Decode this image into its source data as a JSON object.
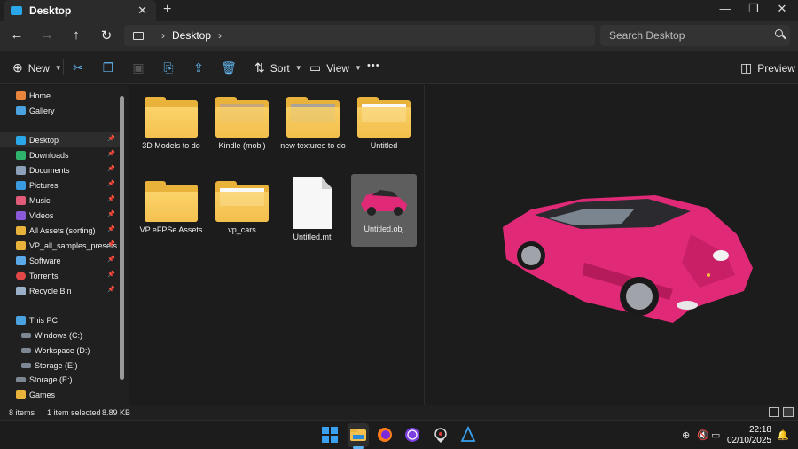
{
  "window": {
    "tab_title": "Desktop",
    "tab_close": "✕",
    "new_tab": "+",
    "minimize": "—",
    "restore": "❐",
    "close": "✕"
  },
  "nav": {
    "back": "←",
    "forward": "→",
    "up": "↑",
    "refresh": "↻",
    "address_sep": "›",
    "breadcrumb": "Desktop",
    "search_placeholder": "Search Desktop"
  },
  "toolbar": {
    "new_label": "New",
    "sort_label": "Sort",
    "view_label": "View",
    "more_label": "•••",
    "preview_label": "Preview"
  },
  "sidebar": {
    "quick": [
      {
        "label": "Home",
        "icon": "home-icon",
        "color": "#e8843c"
      },
      {
        "label": "Gallery",
        "icon": "gallery-icon",
        "color": "#4aa3e0"
      }
    ],
    "pinned": [
      {
        "label": "Desktop",
        "icon": "desktop-icon",
        "color": "#2aa7e8"
      },
      {
        "label": "Downloads",
        "icon": "downloads-icon",
        "color": "#2fb36b"
      },
      {
        "label": "Documents",
        "icon": "documents-icon",
        "color": "#8ca0b8"
      },
      {
        "label": "Pictures",
        "icon": "pictures-icon",
        "color": "#3a9be0"
      },
      {
        "label": "Music",
        "icon": "music-icon",
        "color": "#e05a7a"
      },
      {
        "label": "Videos",
        "icon": "videos-icon",
        "color": "#8a5ad8"
      },
      {
        "label": "All Assets (sorting)",
        "icon": "folder-icon",
        "color": "#e9b33b"
      },
      {
        "label": "VP_all_samples_presets",
        "icon": "folder-icon",
        "color": "#e9b33b"
      },
      {
        "label": "Software",
        "icon": "monitor-icon",
        "color": "#5aa9e6"
      },
      {
        "label": "Torrents",
        "icon": "magnet-icon",
        "color": "#e04848"
      },
      {
        "label": "Recycle Bin",
        "icon": "recycle-bin-icon",
        "color": "#9ab0c8"
      }
    ],
    "this_pc": "This PC",
    "drives": [
      {
        "label": "Windows (C:)",
        "icon": "drive-icon"
      },
      {
        "label": "Workspace (D:)",
        "icon": "drive-icon"
      },
      {
        "label": "Storage (E:)",
        "icon": "drive-icon"
      }
    ],
    "storage_root": "Storage (E:)",
    "games": "Games"
  },
  "files": [
    {
      "name": "3D Models to do",
      "type": "folder"
    },
    {
      "name": "Kindle (mobi)",
      "type": "folder"
    },
    {
      "name": "new textures to do",
      "type": "folder"
    },
    {
      "name": "Untitled",
      "type": "folder"
    },
    {
      "name": "VP eFPSe Assets",
      "type": "folder"
    },
    {
      "name": "vp_cars",
      "type": "folder"
    },
    {
      "name": "Untitled.mtl",
      "type": "file"
    },
    {
      "name": "Untitled.obj",
      "type": "file",
      "selected": true
    }
  ],
  "status": {
    "count": "8 items",
    "selection": "1 item selected",
    "size": "8.89 KB"
  },
  "taskbar": {
    "time": "22:18",
    "date": "02/10/2025"
  },
  "colors": {
    "accent": "#60b6f0",
    "car": "#e02a78"
  }
}
